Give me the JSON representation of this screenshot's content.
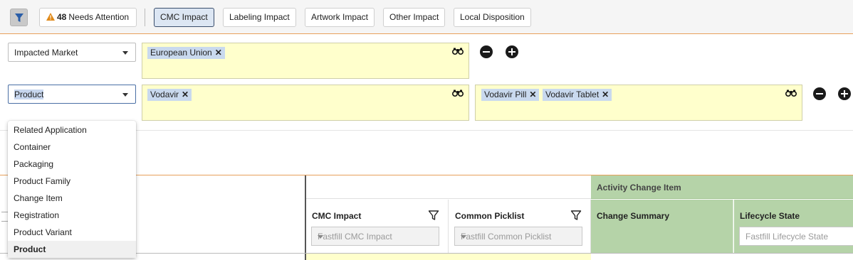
{
  "toolbar": {
    "needs_attention_count": "48",
    "needs_attention_label": "Needs Attention",
    "tabs": [
      {
        "label": "CMC Impact",
        "active": true
      },
      {
        "label": "Labeling Impact",
        "active": false
      },
      {
        "label": "Artwork Impact",
        "active": false
      },
      {
        "label": "Other Impact",
        "active": false
      },
      {
        "label": "Local Disposition",
        "active": false
      }
    ]
  },
  "conditions": [
    {
      "field": "Impacted Market",
      "values": [
        "European Union"
      ]
    },
    {
      "field": "Product",
      "values": [
        "Vodavir"
      ],
      "sub_values": [
        "Vodavir Pill",
        "Vodavir Tablet"
      ]
    }
  ],
  "dropdown": {
    "options": [
      "Related Application",
      "Container",
      "Packaging",
      "Product Family",
      "Change Item",
      "Registration",
      "Product Variant",
      "Product"
    ],
    "selected": "Product"
  },
  "grid": {
    "group_header": "Activity Change Item",
    "columns": [
      {
        "title": "CMC Impact",
        "placeholder": "Fastfill CMC Impact"
      },
      {
        "title": "Common Picklist",
        "placeholder": "Fastfill Common Picklist"
      },
      {
        "title": "Change Summary",
        "placeholder": ""
      },
      {
        "title": "Lifecycle State",
        "placeholder": "Fastfill Lifecycle State"
      }
    ]
  },
  "colors": {
    "accent_orange": "#e8a05a",
    "value_box_yellow": "#ffffcc",
    "tag_blue": "#c9d9ee",
    "group_green": "#b5d3a8",
    "active_tab": "#dce6f3"
  }
}
